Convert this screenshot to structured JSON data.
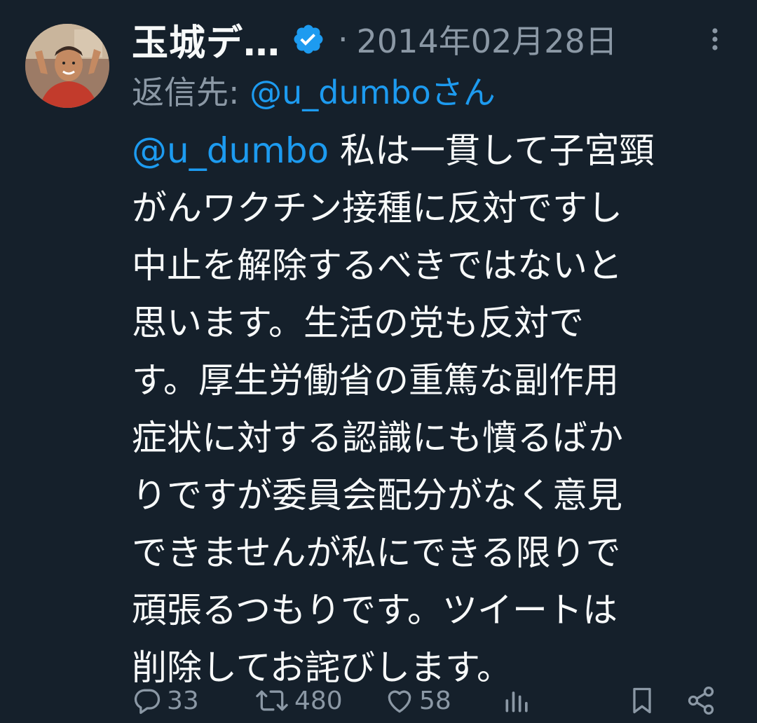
{
  "tweet": {
    "author_name": "玉城デ…",
    "separator": "·",
    "date": "2014年02月28日",
    "reply_label": "返信先: ",
    "reply_handle": "@u_dumboさん",
    "mention": "@u_dumbo",
    "text_lines": [
      " 私は一貫して子宮頸",
      "がんワクチン接種に反対ですし",
      "中止を解除するべきではないと",
      "思います。生活の党も反対で",
      "す。厚生労働省の重篤な副作用",
      "症状に対する認識にも憤るばか",
      "りですが委員会配分がなく意見",
      "できませんが私にできる限りで",
      "頑張るつもりです。ツイートは",
      "削除してお詫びします。"
    ]
  },
  "actions": {
    "reply_count": "33",
    "retweet_count": "480",
    "like_count": "58"
  },
  "colors": {
    "background": "#15202b",
    "text": "#f7f9f9",
    "muted": "#8b98a5",
    "accent": "#1d9bf0"
  },
  "icons": [
    "verified-badge-icon",
    "more-icon",
    "reply-icon",
    "retweet-icon",
    "like-icon",
    "views-icon",
    "bookmark-icon",
    "share-icon"
  ]
}
